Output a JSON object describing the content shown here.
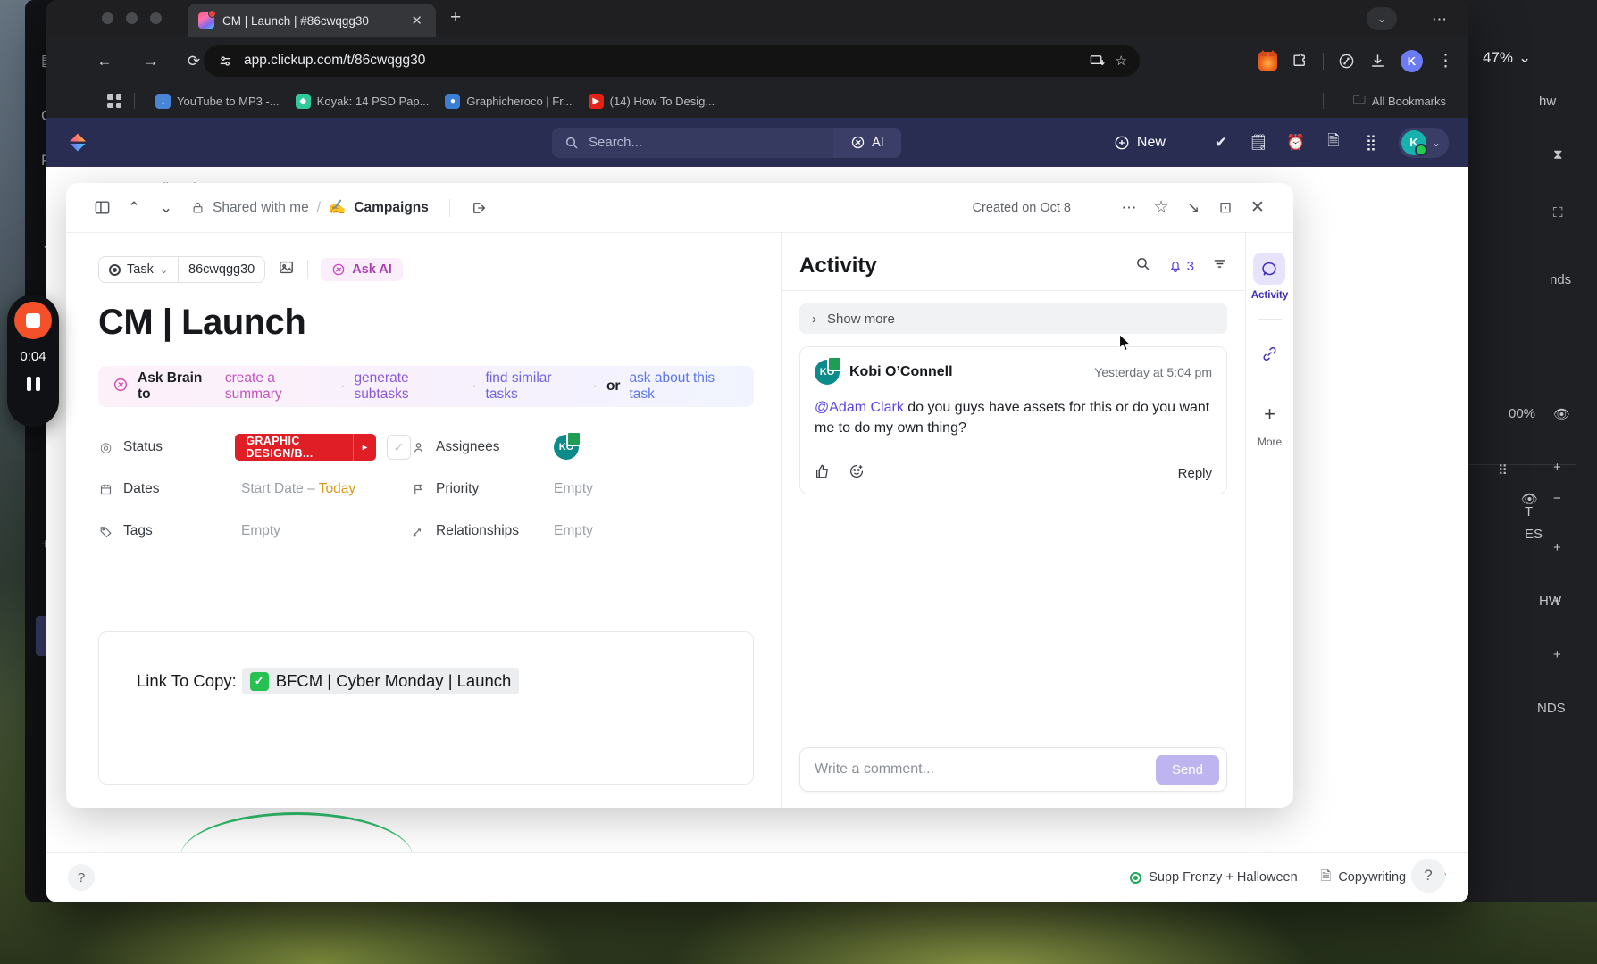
{
  "browser": {
    "tab": {
      "title": "CM | Launch | #86cwqgg30",
      "close": "✕",
      "favicon": "clickup-favicon"
    },
    "new_tab": "+",
    "window_chevron": "⌄",
    "window_menu": "⋯",
    "nav": {
      "back": "←",
      "forward": "→",
      "reload": "⟳"
    },
    "omnibox": {
      "url": "app.clickup.com/t/86cwqgg30",
      "site_info_icon": "tune-icon",
      "cast_icon": "install-icon",
      "star_icon": "☆"
    },
    "toolbar_icons": [
      "metamask-fox-icon",
      "extensions-icon",
      "leaf-icon",
      "downloads-icon",
      "profile-avatar"
    ],
    "profile_initial": "K",
    "menu_dots": "⋮",
    "zoom_level": "47%",
    "bookmarks": [
      {
        "label": "YouTube to MP3 -...",
        "color": "#4a86d8",
        "glyph": "↓"
      },
      {
        "label": "Koyak: 14 PSD Pap...",
        "color": "#2fc99a",
        "glyph": "◆"
      },
      {
        "label": "Graphicheroco | Fr...",
        "color": "#3b7fd4",
        "glyph": "●"
      },
      {
        "label": "(14) How To Desig...",
        "color": "#e62117",
        "glyph": "▶"
      }
    ],
    "all_bookmarks": "All Bookmarks"
  },
  "clickup_header": {
    "search_placeholder": "Search...",
    "ai_label": "AI",
    "new_label": "New",
    "icons": [
      "checkmark-circle-icon",
      "clipboard-icon",
      "alarm-clock-icon",
      "document-icon",
      "apps-grid-icon"
    ],
    "avatar_initial": "K",
    "avatar_chevron": "⌄"
  },
  "modal": {
    "header": {
      "panel_toggle": "sidebar-toggle",
      "prev": "⌃",
      "next": "⌄",
      "lock_icon": "🔒",
      "crumb_shared": "Shared with me",
      "crumb_slash": "/",
      "crumb_space_emoji": "✍️",
      "crumb_space": "Campaigns",
      "open_icon": "open-in-new",
      "created": "Created on Oct 8",
      "more": "⋯",
      "star": "☆",
      "collapse": "↘",
      "split": "⊡",
      "close": "✕"
    },
    "task": {
      "type_label": "Task",
      "type_chevron": "⌄",
      "task_id": "86cwqgg30",
      "image_icon": "image-icon",
      "ask_ai": "Ask AI",
      "title": "CM | Launch",
      "brain": {
        "prefix": "Ask Brain to",
        "link1": "create a summary",
        "dot1": "·",
        "link2": "generate subtasks",
        "dot2": "·",
        "link3": "find similar tasks",
        "dot3": "·",
        "or": "or",
        "link4": "ask about this task"
      },
      "fields": {
        "status_label": "Status",
        "status_value": "GRAPHIC DESIGN/B...",
        "status_color": "#e01e25",
        "status_arrow": "▸",
        "assignees_label": "Assignees",
        "assignee_initials": "KO",
        "dates_label": "Dates",
        "dates_start": "Start Date –",
        "dates_end": "Today",
        "priority_label": "Priority",
        "priority_value": "Empty",
        "tags_label": "Tags",
        "tags_value": "Empty",
        "relationships_label": "Relationships",
        "relationships_value": "Empty"
      },
      "link_card": {
        "label": "Link To Copy:",
        "check": "✓",
        "link_text": "BFCM | Cyber Monday | Launch"
      }
    },
    "activity": {
      "title": "Activity",
      "search_icon": "search-icon",
      "bell_icon": "bell-icon",
      "bell_count": "3",
      "filter_icon": "filter-icon",
      "show_more": "Show more",
      "show_more_chevron": "›",
      "comment": {
        "avatar_initials": "KO",
        "author": "Kobi O’Connell",
        "time": "Yesterday at 5:04 pm",
        "mention": "@Adam Clark",
        "text": " do you guys have assets for this or do you want me to do my own thing?",
        "like_icon": "thumbs-up-icon",
        "react_icon": "add-reaction-icon",
        "reply": "Reply"
      },
      "composer": {
        "placeholder": "Write a comment...",
        "send": "Send"
      }
    },
    "rail": {
      "activity_label": "Activity",
      "activity_icon": "chat-bubble-icon",
      "link_icon": "link-icon",
      "more_icon": "+",
      "more_label": "More"
    }
  },
  "footer": {
    "help": "?",
    "item1": "Supp Frenzy + Halloween",
    "item2": "Copywriting",
    "pin_icon": "pin-icon",
    "help_fab": "?"
  },
  "recorder": {
    "time": "0:04",
    "stop_icon": "stop-icon",
    "pause_icon": "pause-icon"
  },
  "bg_app": {
    "right_zoom": "00%",
    "right_labels": [
      "nds",
      "T",
      "ES",
      "NDS",
      "HW",
      "hw"
    ],
    "left_labels": [
      "C",
      "P"
    ]
  }
}
